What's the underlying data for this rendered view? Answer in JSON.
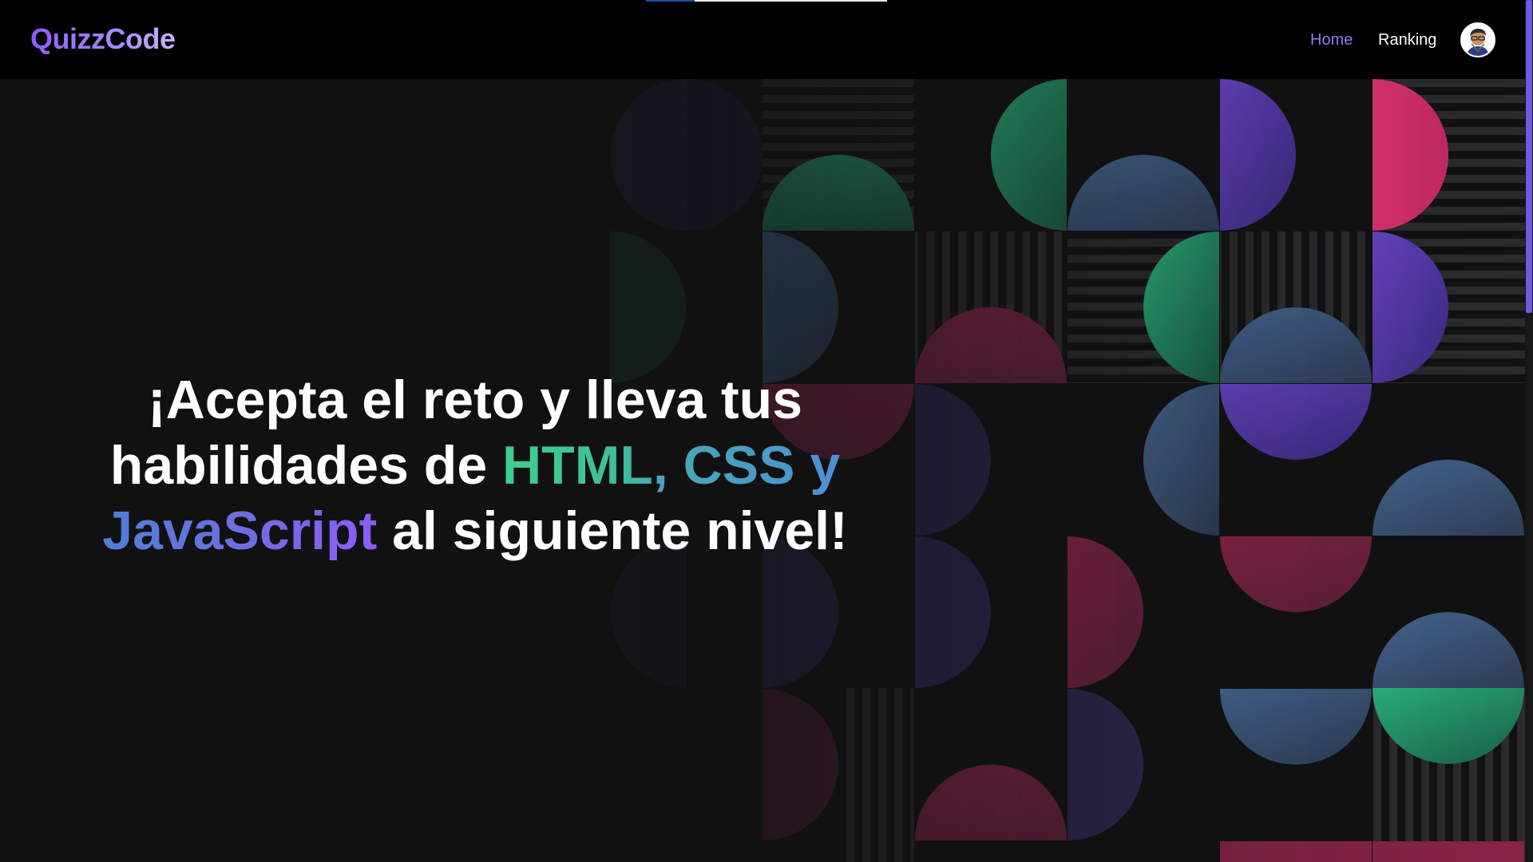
{
  "app": {
    "logo_text": "QuizzCode"
  },
  "nav": {
    "home_label": "Home",
    "ranking_label": "Ranking",
    "avatar_alt": "user avatar"
  },
  "hero": {
    "line1": "¡Acepta el reto y lleva tus",
    "line2_prefix": "habilidades de ",
    "highlight_html": "HTML,",
    "highlight_css": "CSS y",
    "highlight_js": "JavaScript",
    "line3_suffix": " al siguiente nivel!"
  },
  "colors": {
    "accent_purple": "#8b5cf6",
    "accent_green": "#3ecf8e",
    "accent_blue": "#4d8fd4",
    "background": "#111112",
    "navbar": "#000000"
  },
  "icons": {
    "avatar": "avatar-icon"
  }
}
